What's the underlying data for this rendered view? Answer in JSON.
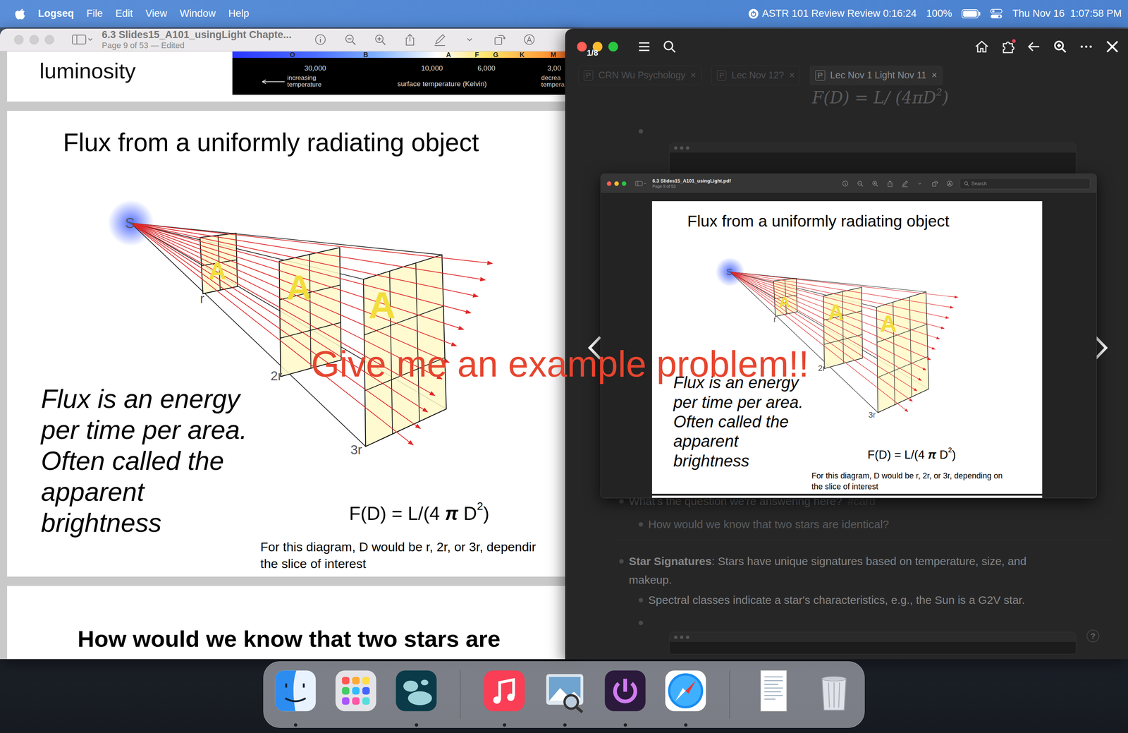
{
  "menubar": {
    "app": "Logseq",
    "menus": [
      "File",
      "Edit",
      "View",
      "Window",
      "Help"
    ],
    "timer": "ASTR 101 Review Review 0:16:24",
    "battery": "100%",
    "battery_level": 1,
    "clock": "Thu Nov 16  1:07:58 PM"
  },
  "preview": {
    "title": "6.3 Slides15_A101_usingLight Chapte...",
    "subtitle": "Page 9 of 53 — Edited",
    "prev_slide": {
      "heading": "luminosity",
      "classes": [
        "O",
        "B",
        "A",
        "F",
        "G",
        "K",
        "M"
      ],
      "ticks": [
        "30,000",
        "10,000",
        "6,000",
        "3,00"
      ],
      "axis": "surface temperature (Kelvin)",
      "left_note": [
        "increasing",
        "temperature"
      ],
      "right_note": [
        "decrea",
        "tempera"
      ]
    },
    "slide": {
      "title": "Flux from a uniformly radiating object",
      "labels": {
        "source": "S",
        "near": "r",
        "mid": "2r",
        "far": "3r",
        "area": "A"
      },
      "body": [
        "Flux is an energy",
        "per time per area.",
        "Often called the",
        "apparent",
        "brightness"
      ],
      "formula": {
        "lhs": "F(D) = L/(4 ",
        "pi": "π",
        "d": " D",
        "exp": "2",
        "end": ")"
      },
      "caption": [
        "For this diagram, D would be r, 2r, or 3r, dependir",
        "the slice of interest"
      ]
    },
    "next_slide": {
      "heading": "How would we know that two stars are"
    }
  },
  "overlay": {
    "text": "Give me an example problem!!"
  },
  "logseq": {
    "tabs": [
      {
        "label": "CRN Wu Psychology",
        "icon": "P",
        "close": "×",
        "selected": false
      },
      {
        "label": "Lec Nov 12?",
        "icon": "P",
        "close": "×",
        "selected": false
      },
      {
        "label": "Lec Nov 1 Light Nov 11",
        "icon": "P",
        "close": "×",
        "selected": true
      }
    ],
    "formula": {
      "lhs": "F(D) = L/ (4",
      "pi": "π",
      "d": "D",
      "exp": "2",
      "end": ")"
    },
    "lightbox": {
      "counter": "1/8",
      "image": {
        "title": "6.3 Slides15_A101_usingLight.pdf",
        "subtitle": "Page 9 of 53",
        "search": "Search",
        "slide": {
          "title": "Flux from a uniformly radiating object",
          "labels": {
            "source": "S",
            "near": "r",
            "mid": "2r",
            "far": "3r",
            "area": "A"
          },
          "body": [
            "Flux is an energy",
            "per time per area.",
            "Often called the",
            "apparent",
            "brightness"
          ],
          "formula": {
            "lhs": "F(D) = L/(4 ",
            "pi": "π",
            "d": " D",
            "exp": "2",
            "end": ")"
          },
          "caption": [
            "For this diagram, D would be r, 2r, or 3r, depending on",
            "the slice of interest"
          ]
        }
      }
    },
    "blocks": {
      "question": "What's the question we're answering here?",
      "tag": "#card",
      "answer": "How would we know that two stars are identical?",
      "sig_label": "Star Signatures",
      "sig_text": ": Stars have unique signatures based on temperature, size, and",
      "sig_cont": "makeup.",
      "spectral": "Spectral classes indicate a star's characteristics, e.g., the Sun is a G2V star."
    },
    "help": "?"
  },
  "dock": [
    {
      "kind": "finder",
      "running": true
    },
    {
      "kind": "launchpad",
      "running": false
    },
    {
      "kind": "logseq",
      "running": true
    },
    {
      "kind": "separator"
    },
    {
      "kind": "music",
      "running": true
    },
    {
      "kind": "preview",
      "running": true
    },
    {
      "kind": "power",
      "running": true
    },
    {
      "kind": "safari",
      "running": true
    },
    {
      "kind": "separator"
    },
    {
      "kind": "document",
      "running": false
    },
    {
      "kind": "trash",
      "running": false
    }
  ]
}
